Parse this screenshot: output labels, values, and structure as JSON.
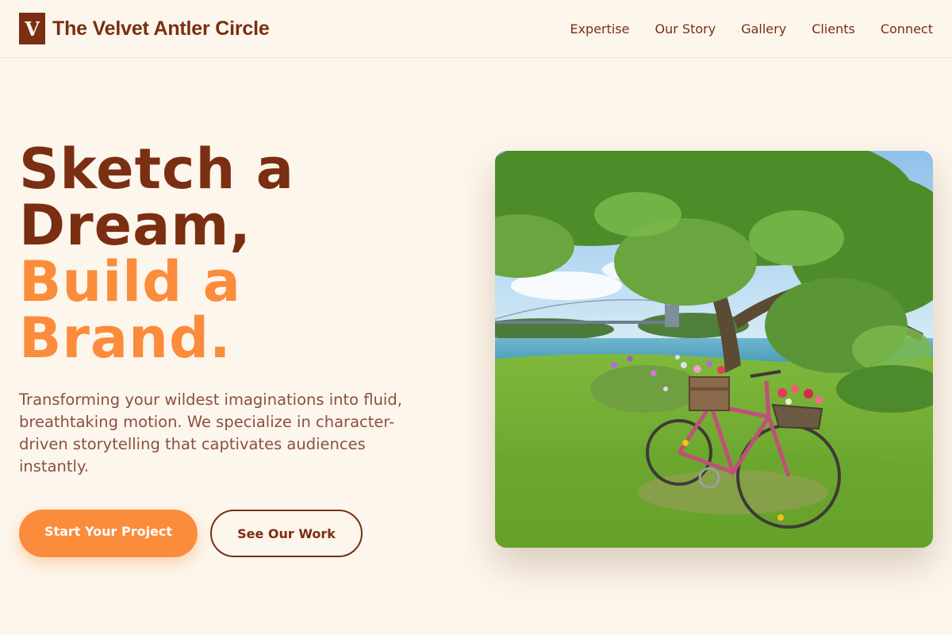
{
  "brand": {
    "logo_letter": "V",
    "name": "The Velvet Antler Circle"
  },
  "nav": {
    "items": [
      "Expertise",
      "Our Story",
      "Gallery",
      "Clients",
      "Connect"
    ]
  },
  "hero": {
    "title_line1": "Sketch a",
    "title_line2": "Dream,",
    "title_line3": "Build a",
    "title_line4": "Brand.",
    "description": "Transforming your wildest imaginations into fluid, breathtaking motion. We specialize in character-driven storytelling that captivates audiences instantly.",
    "primary_button": "Start Your Project",
    "secondary_button": "See Our Work",
    "image_alt": "Pink bicycle with flower baskets under a large tree by a river with a suspension bridge"
  },
  "colors": {
    "background": "#fdf6ec",
    "brand_dark": "#7a2e12",
    "accent_orange": "#fb8c3c",
    "body_text": "#8a5040"
  }
}
